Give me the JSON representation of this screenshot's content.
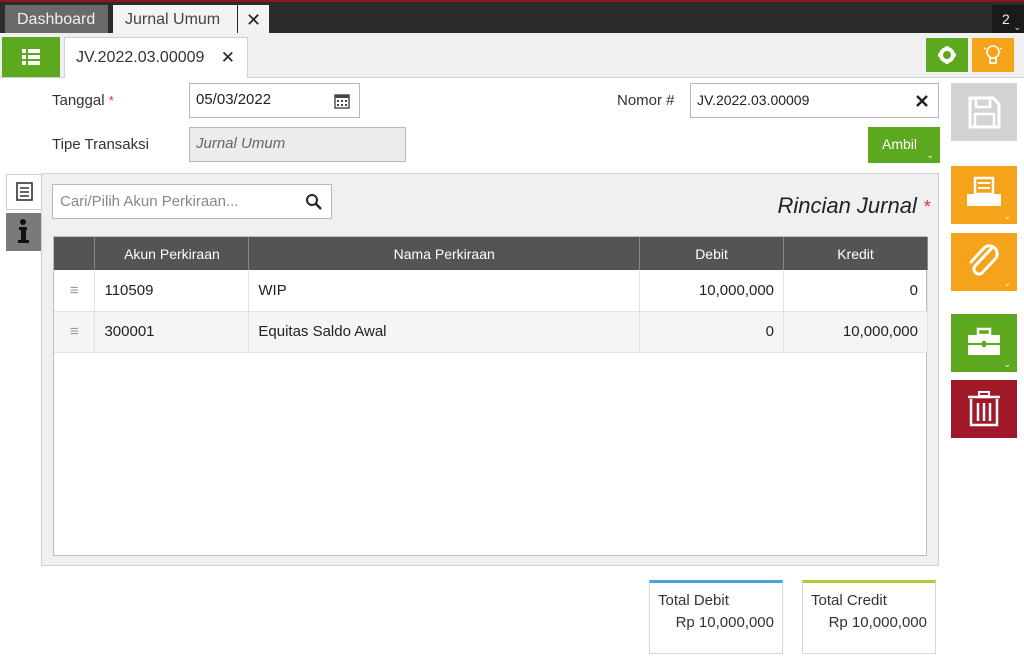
{
  "top_tabs": {
    "dashboard": "Dashboard",
    "jurnal_umum": "Jurnal Umum",
    "close": "✕",
    "count": "2"
  },
  "doc_tab": {
    "label": "JV.2022.03.00009",
    "close": "✕"
  },
  "form": {
    "tanggal_label": "Tanggal",
    "required_mark": "*",
    "tanggal_value": "05/03/2022",
    "nomor_label": "Nomor #",
    "nomor_value": "JV.2022.03.00009",
    "tipe_label": "Tipe Transaksi",
    "tipe_value": "Jurnal Umum",
    "ambil_label": "Ambil"
  },
  "detail": {
    "search_placeholder": "Cari/Pilih Akun Perkiraan...",
    "title": "Rincian Jurnal",
    "required_mark": "*",
    "columns": [
      "Akun Perkiraan",
      "Nama Perkiraan",
      "Debit",
      "Kredit"
    ],
    "rows": [
      {
        "akun": "110509",
        "nama": "WIP",
        "debit": "10,000,000",
        "kredit": "0"
      },
      {
        "akun": "300001",
        "nama": "Equitas Saldo Awal",
        "debit": "0",
        "kredit": "10,000,000"
      }
    ]
  },
  "totals": {
    "debit_label": "Total Debit",
    "debit_value": "Rp 10,000,000",
    "credit_label": "Total Credit",
    "credit_value": "Rp 10,000,000"
  },
  "colors": {
    "green": "#5ca81e",
    "orange": "#f5a31a",
    "red": "#a01929",
    "header": "#545454",
    "debit_accent": "#4aa3df",
    "credit_accent": "#b5c938"
  },
  "icons": [
    "list-icon",
    "gear-icon",
    "bulb-icon",
    "calendar-icon",
    "clear-icon",
    "search-icon",
    "detail-list-icon",
    "info-icon",
    "save-icon",
    "print-icon",
    "attach-icon",
    "toolbox-icon",
    "trash-icon",
    "drag-handle-icon"
  ]
}
